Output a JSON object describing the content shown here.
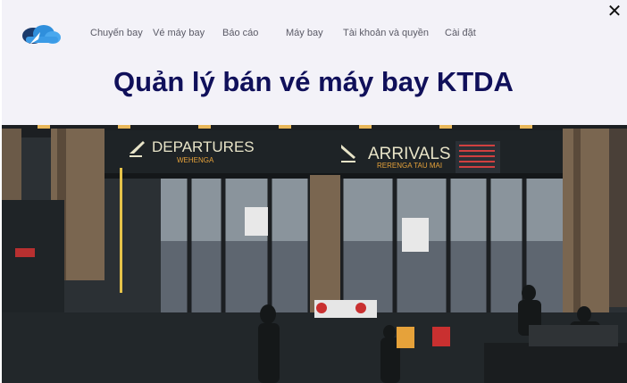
{
  "nav": {
    "items": [
      {
        "label": "Chuyến bay"
      },
      {
        "label": "Vé máy bay"
      },
      {
        "label": "Báo cáo"
      },
      {
        "label": "Máy bay"
      },
      {
        "label": "Tài khoản và quyền"
      },
      {
        "label": "Cài đặt"
      }
    ]
  },
  "close": {
    "label": "✕"
  },
  "page": {
    "title": "Quản lý bán vé máy bay KTDA"
  },
  "hero": {
    "signs": {
      "departures": "DEPARTURES",
      "departures_sub": "WEHENGA",
      "arrivals": "ARRIVALS",
      "arrivals_sub": "RERENGA TAU MAI"
    }
  },
  "icons": {
    "logo": "cloud-logo-icon",
    "close": "close-icon",
    "departure_plane": "plane-departure-icon",
    "arrival_plane": "plane-arrival-icon"
  },
  "colors": {
    "header_bg": "#f3f2f8",
    "title": "#10105a",
    "nav_text": "#5a5a66",
    "logo_blue": "#2f8fdc",
    "logo_dark": "#1b3a6b",
    "sign_text": "#e8e4c8",
    "sign_sub": "#e6a23a"
  }
}
